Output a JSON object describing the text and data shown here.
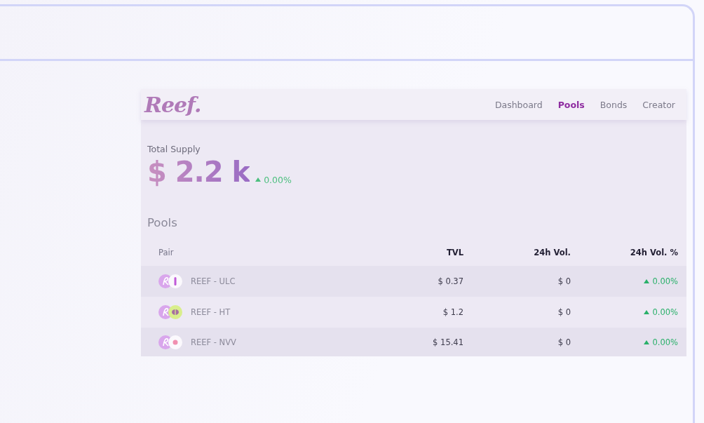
{
  "logo": "Reef.",
  "nav": [
    {
      "label": "Dashboard",
      "selected": false
    },
    {
      "label": "Pools",
      "selected": true
    },
    {
      "label": "Bonds",
      "selected": false
    },
    {
      "label": "Creator",
      "selected": false
    }
  ],
  "supply": {
    "label": "Total Supply",
    "value": "$ 2.2 k",
    "change": "0.00%",
    "up": true
  },
  "pools": {
    "title": "Pools",
    "columns": [
      "Pair",
      "TVL",
      "24h Vol.",
      "24h Vol. %"
    ],
    "rows": [
      {
        "kind": "ulc",
        "pair": "REEF - ULC",
        "tvl": "$ 0.37",
        "vol": "$ 0",
        "vol_change": "0.00%",
        "up": true
      },
      {
        "kind": "ht",
        "pair": "REEF - HT",
        "tvl": "$ 1.2",
        "vol": "$ 0",
        "vol_change": "0.00%",
        "up": true
      },
      {
        "kind": "nvv",
        "pair": "REEF - NVV",
        "tvl": "$ 15.41",
        "vol": "$ 0",
        "vol_change": "0.00%",
        "up": true
      }
    ]
  }
}
